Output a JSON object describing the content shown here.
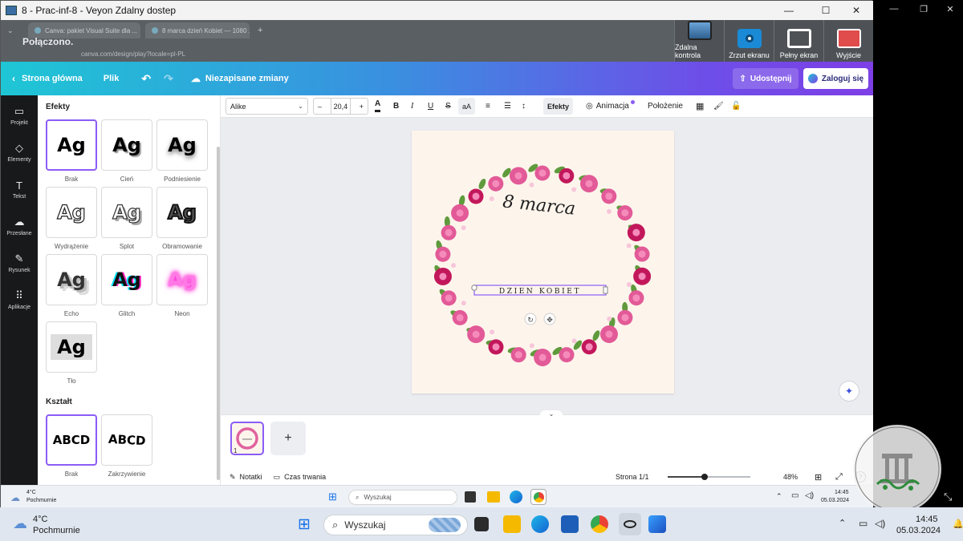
{
  "window": {
    "title": "8 - Prac-inf-8 - Veyon Zdalny dostep",
    "minimize": "—",
    "maximize": "☐",
    "close": "✕"
  },
  "remote_browser": {
    "tabs": [
      {
        "label": "Canva: pakiet Visual Suite dla ..."
      },
      {
        "label": "8 marca dzień Kobiet — 1080 ..."
      }
    ],
    "status": "Połączono.",
    "url": "canva.com/design/play?locale=pl-PL"
  },
  "veyon_tools": [
    {
      "label": "Zdalna kontrola",
      "icon": "remote-control-icon"
    },
    {
      "label": "Zrzut ekranu",
      "icon": "screenshot-icon"
    },
    {
      "label": "Pełny ekran",
      "icon": "fullscreen-icon"
    },
    {
      "label": "Wyjście",
      "icon": "exit-icon"
    }
  ],
  "canva_header": {
    "home": "Strona główna",
    "file": "Plik",
    "unsaved": "Niezapisane zmiany",
    "share": "Udostępnij",
    "login": "Zaloguj się"
  },
  "rail": [
    {
      "label": "Projekt",
      "icon": "▭"
    },
    {
      "label": "Elementy",
      "icon": "◇"
    },
    {
      "label": "Tekst",
      "icon": "T"
    },
    {
      "label": "Przesłane",
      "icon": "☁"
    },
    {
      "label": "Rysunek",
      "icon": "✎"
    },
    {
      "label": "Aplikacje",
      "icon": "⠿"
    }
  ],
  "panel": {
    "effects_title": "Efekty",
    "shape_title": "Kształt",
    "sample": "Ag",
    "effects": [
      "Brak",
      "Cień",
      "Podniesienie",
      "Wydrążenie",
      "Splot",
      "Obramowanie",
      "Echo",
      "Glitch",
      "Neon",
      "Tło"
    ],
    "shapes": [
      {
        "label": "Brak",
        "sample": "ABCD"
      },
      {
        "label": "Zakrzywienie",
        "sample": "ABCD"
      }
    ]
  },
  "toolbar": {
    "font": "Alike",
    "size": "20,4",
    "minus": "–",
    "plus": "+",
    "effects": "Efekty",
    "animation": "Animacja",
    "position": "Położenie"
  },
  "design": {
    "title_text": "8 marca",
    "subtitle_text": "DZIEN KOBIET",
    "accent": "#8b5cf6",
    "background": "#fdf5ec"
  },
  "bottom": {
    "page_number": "1",
    "add_page": "+",
    "notes": "Notatki",
    "duration": "Czas trwania",
    "page_indicator": "Strona 1/1",
    "zoom": "48%",
    "zoom_level": 0.45
  },
  "remote_taskbar": {
    "temp": "4°C",
    "weather": "Pochmurnie",
    "search": "Wyszukaj",
    "time": "14:45",
    "date": "05.03.2024"
  },
  "local_taskbar": {
    "temp": "4°C",
    "weather": "Pochmurnie",
    "search": "Wyszukaj",
    "time": "14:45",
    "date": "05.03.2024"
  },
  "seal": {
    "text": "GMINNY OŚRODEK KULTURY W STAWISZYCACH"
  }
}
